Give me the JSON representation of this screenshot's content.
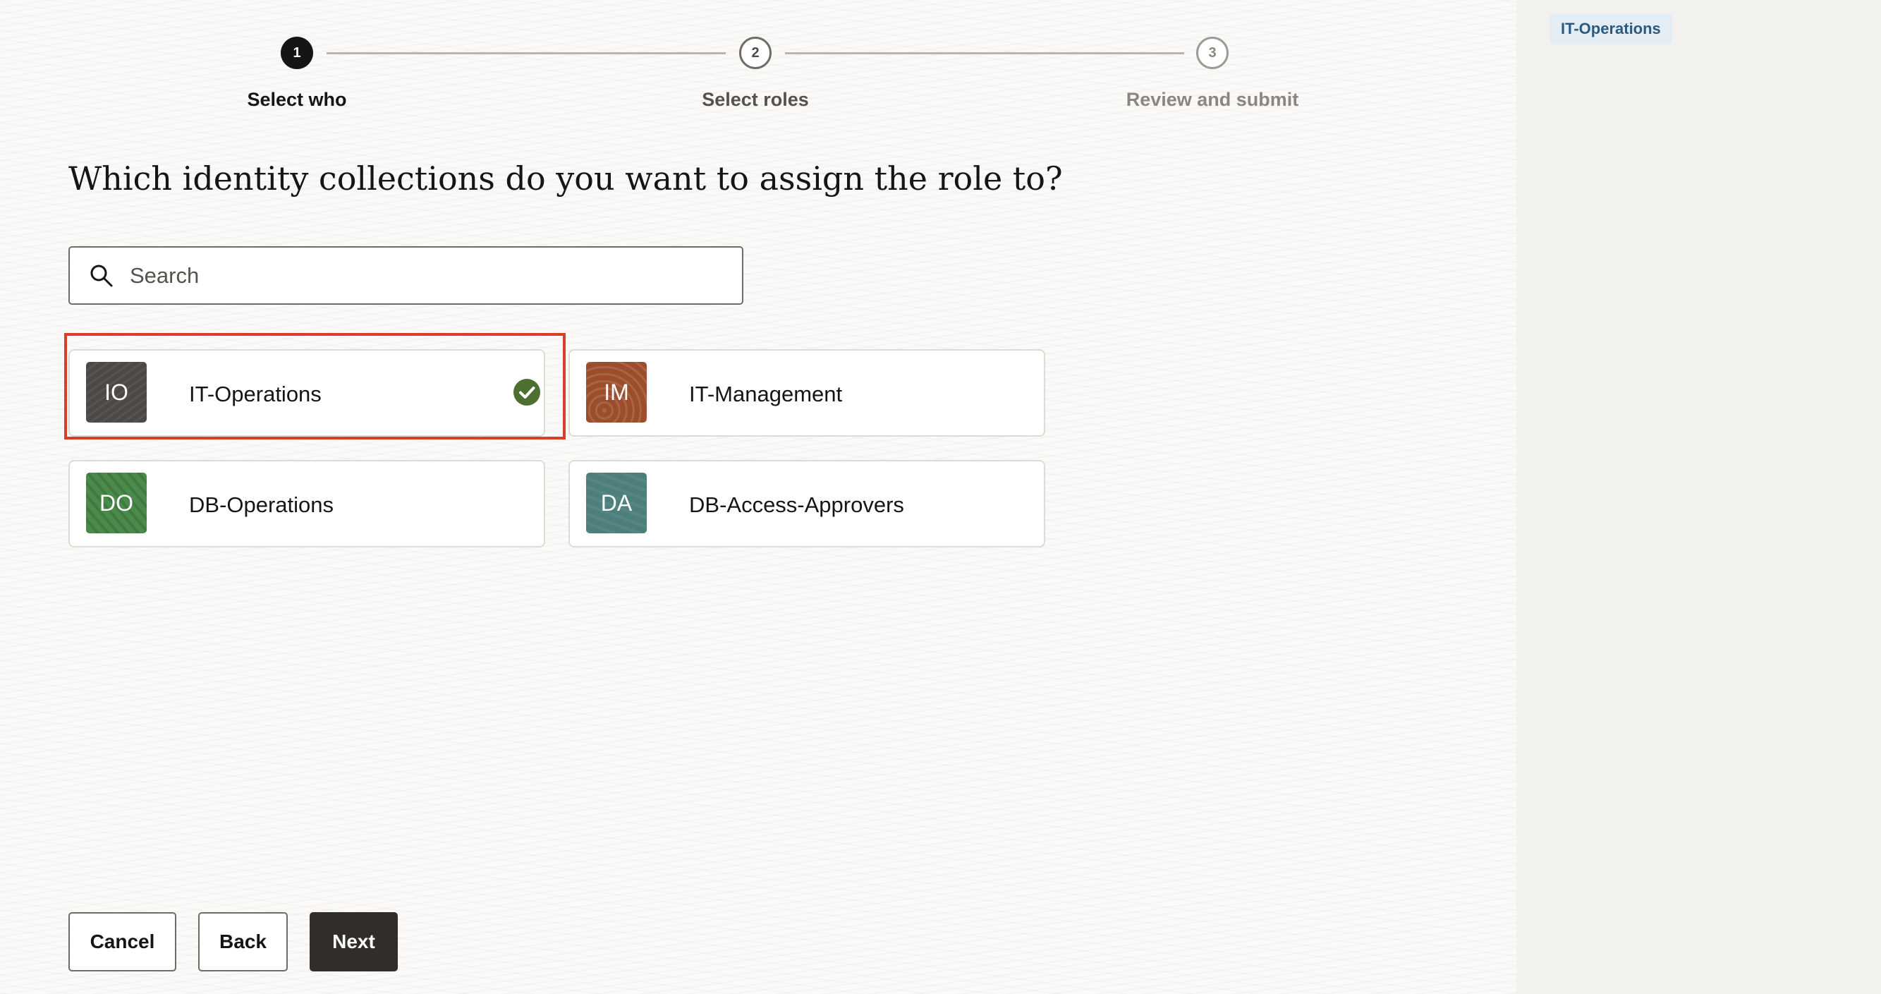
{
  "stepper": {
    "steps": [
      {
        "number": "1",
        "label": "Select who",
        "state": "active"
      },
      {
        "number": "2",
        "label": "Select roles",
        "state": "upcoming"
      },
      {
        "number": "3",
        "label": "Review and submit",
        "state": "upcoming"
      }
    ]
  },
  "main": {
    "question": "Which identity collections do you want to assign the role to?",
    "search": {
      "placeholder": "Search",
      "value": ""
    },
    "collections": [
      {
        "initials": "IO",
        "name": "IT-Operations",
        "selected": true
      },
      {
        "initials": "IM",
        "name": "IT-Management",
        "selected": false
      },
      {
        "initials": "DO",
        "name": "DB-Operations",
        "selected": false
      },
      {
        "initials": "DA",
        "name": "DB-Access-Approvers",
        "selected": false
      }
    ]
  },
  "footer": {
    "cancel_label": "Cancel",
    "back_label": "Back",
    "next_label": "Next"
  },
  "side": {
    "selected_chips": [
      "IT-Operations"
    ]
  },
  "colors": {
    "highlight": "#d73f2a",
    "check": "#4d6f2f",
    "primary_button": "#312d2a",
    "chip_bg": "#e4edf4",
    "chip_text": "#2a5a80"
  }
}
